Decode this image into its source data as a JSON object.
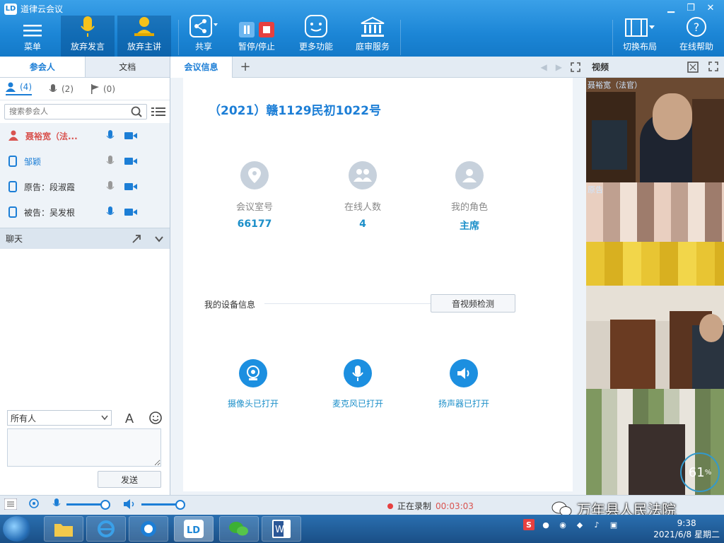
{
  "app": {
    "title": "道律云会议",
    "logo_text": "LD"
  },
  "toolbar": {
    "menu": "菜单",
    "give_up_speak": "放弃发言",
    "give_up_host": "放弃主讲",
    "share": "共享",
    "record": "暂停/停止",
    "more": "更多功能",
    "court": "庭审服务",
    "layout": "切换布局",
    "help": "在线帮助"
  },
  "left": {
    "tab_participants": "参会人",
    "tab_docs": "文档",
    "count_people": "(4)",
    "count_mic": "(2)",
    "count_flag": "(0)",
    "search_placeholder": "搜索参会人",
    "participants": [
      {
        "name": "聂裕宽（法...",
        "color": "#d9534f"
      },
      {
        "name": "邹颖",
        "color": "#1c7ed6"
      },
      {
        "name": "原告：段淑霞",
        "color": "#333333"
      },
      {
        "name": "被告：吴发根",
        "color": "#333333"
      }
    ],
    "chat_title": "聊天",
    "recipient": "所有人",
    "send": "发送"
  },
  "center": {
    "tab_meeting_info": "会议信息",
    "case_no": "（2021）赣1129民初1022号",
    "room_label": "会议室号",
    "room_value": "66177",
    "online_label": "在线人数",
    "online_value": "4",
    "role_label": "我的角色",
    "role_value": "主席",
    "device_info_label": "我的设备信息",
    "device_check_btn": "音视频检测",
    "camera_status": "摄像头已打开",
    "mic_status": "麦克风已打开",
    "speaker_status": "扬声器已打开"
  },
  "right": {
    "title": "视频",
    "video1_label": "聂裕宽（法官）",
    "video2_label": "原告",
    "percent": "61",
    "percent_unit": "%"
  },
  "status": {
    "recording_label": "正在录制",
    "recording_time": "00:03:03",
    "watermark": "万年县人民法院"
  },
  "taskbar": {
    "time": "9:38",
    "date": "2021/6/8 星期二"
  },
  "colors": {
    "primary": "#1c86d6",
    "accent": "#1c8fc9",
    "record": "#e64040"
  }
}
